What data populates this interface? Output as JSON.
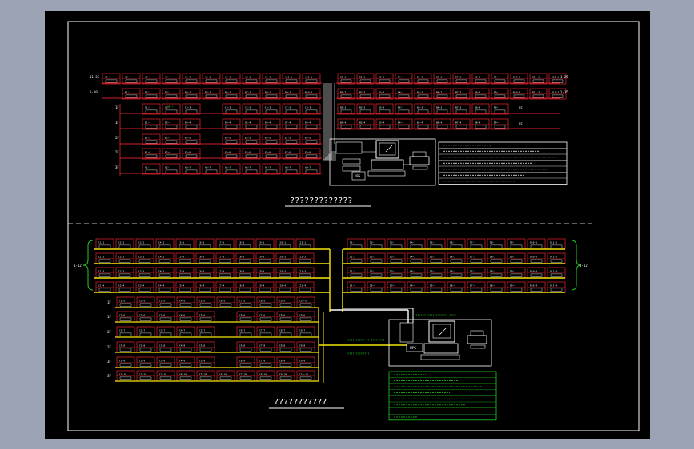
{
  "drawing": {
    "colors": {
      "page_bg": "#9ba3b5",
      "sheet": "#000000",
      "frame": "#ffffff",
      "cell_border": "#d0202a",
      "cell_label": "#ffffff",
      "bus_upper": "#d0202a",
      "bus_lower": "#f5e60a",
      "link": "#ffffff",
      "legend_upper": "#ffffff",
      "legend_lower": "#22cc22",
      "cabinet_label": "#22cc22",
      "cell_label_highlight": "#22cc22"
    },
    "upper_plan": {
      "caption": "?????????????",
      "left_row_labels": [
        "11-25",
        "1-10",
        "1F",
        "1F",
        "2F",
        "2F",
        "3F"
      ],
      "right_row_labels": [
        "1-25",
        "1-15",
        "2F",
        "2F"
      ],
      "highlight_cell_label": "2F-1",
      "console": {
        "ups_label": "UPS"
      }
    },
    "lower_plan": {
      "caption": "???????????",
      "left_bracket_label": "1-12",
      "right_bracket_label": "1-12",
      "left_row_labels": [
        "1F",
        "1F",
        "2F",
        "2F",
        "3F",
        "3F"
      ],
      "cable_label_top": "???????? ???????????? ????",
      "cable_label_mid": "???? ????? ?? ???? ???",
      "cable_label_bottom": "?????????????",
      "ups_label": "UPS"
    }
  }
}
